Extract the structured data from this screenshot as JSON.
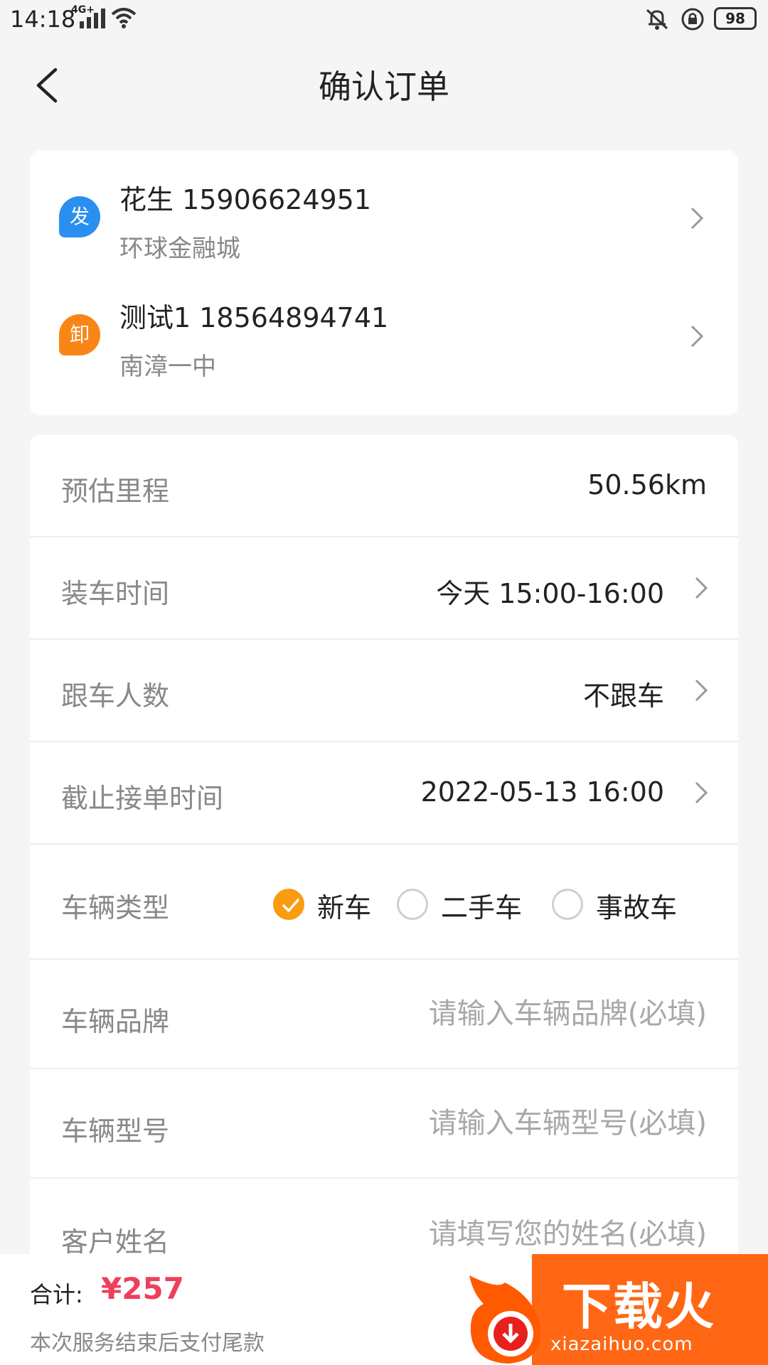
{
  "status_bar": {
    "time": "14:18",
    "network": "4G+",
    "battery": "98"
  },
  "header": {
    "title": "确认订单"
  },
  "addresses": [
    {
      "badge": "发",
      "contact": "花生 15906624951",
      "place": "环球金融城",
      "color": "#2b8ff0"
    },
    {
      "badge": "卸",
      "contact": "测试1 18564894741",
      "place": "南漳一中",
      "color": "#fa8517"
    }
  ],
  "form": {
    "mileage": {
      "label": "预估里程",
      "value": "50.56km"
    },
    "loading_time": {
      "label": "装车时间",
      "value": "今天 15:00-16:00"
    },
    "passengers": {
      "label": "跟车人数",
      "value": "不跟车"
    },
    "deadline": {
      "label": "截止接单时间",
      "value": "2022-05-13 16:00"
    },
    "vehicle_type": {
      "label": "车辆类型",
      "options": [
        "新车",
        "二手车",
        "事故车"
      ],
      "selected": "新车"
    },
    "brand": {
      "label": "车辆品牌",
      "placeholder": "请输入车辆品牌(必填)"
    },
    "model": {
      "label": "车辆型号",
      "placeholder": "请输入车辆型号(必填)"
    },
    "customer_name": {
      "label": "客户姓名",
      "placeholder": "请填写您的姓名(必填)"
    }
  },
  "bottom": {
    "total_label": "合计:",
    "total_price": "¥257",
    "note": "本次服务结束后支付尾款"
  },
  "watermark": {
    "brand": "下载火",
    "domain": "xiazaihuo.com"
  },
  "colors": {
    "accent": "#fa9b10",
    "price": "#ef3f5a"
  }
}
